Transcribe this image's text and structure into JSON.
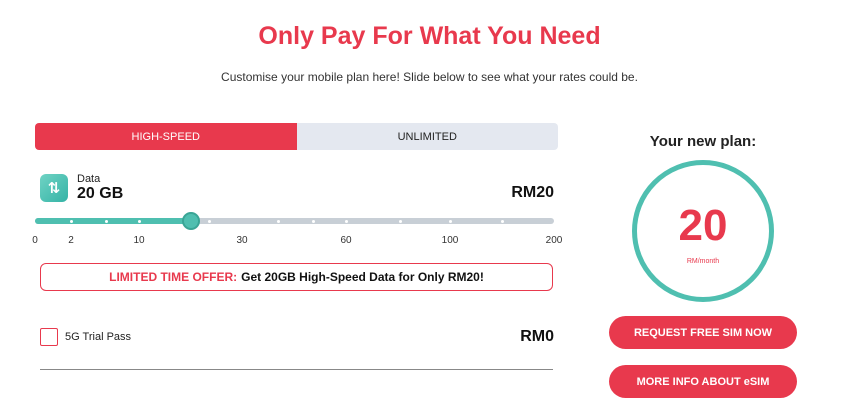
{
  "header": {
    "title": "Only Pay For What You Need",
    "subtitle": "Customise your mobile plan here! Slide below to see what your rates could be."
  },
  "tabs": [
    {
      "label": "HIGH-SPEED",
      "active": true
    },
    {
      "label": "UNLIMITED",
      "active": false
    }
  ],
  "data_plan": {
    "icon": "data-arrows-icon",
    "label": "Data",
    "value": "20 GB",
    "price": "RM20"
  },
  "slider": {
    "selected_value": 20,
    "ticks": [
      "0",
      "2",
      "10",
      "30",
      "60",
      "100",
      "200"
    ],
    "colors": {
      "fill": "#4fbfb0",
      "track": "#c8cfd6"
    }
  },
  "offer": {
    "highlight": "LIMITED TIME OFFER:",
    "text": "Get 20GB High-Speed Data for Only RM20!"
  },
  "trial": {
    "label": "5G Trial Pass",
    "price": "RM0",
    "checked": false
  },
  "summary": {
    "heading": "Your new plan:",
    "amount": "20",
    "unit": "RM/month"
  },
  "buttons": {
    "request_sim": "REQUEST FREE SIM NOW",
    "esim_info": "MORE INFO ABOUT eSIM"
  },
  "colors": {
    "accent": "#e8394d",
    "teal": "#4fbfb0",
    "tab_inactive": "#e4e8f0"
  }
}
